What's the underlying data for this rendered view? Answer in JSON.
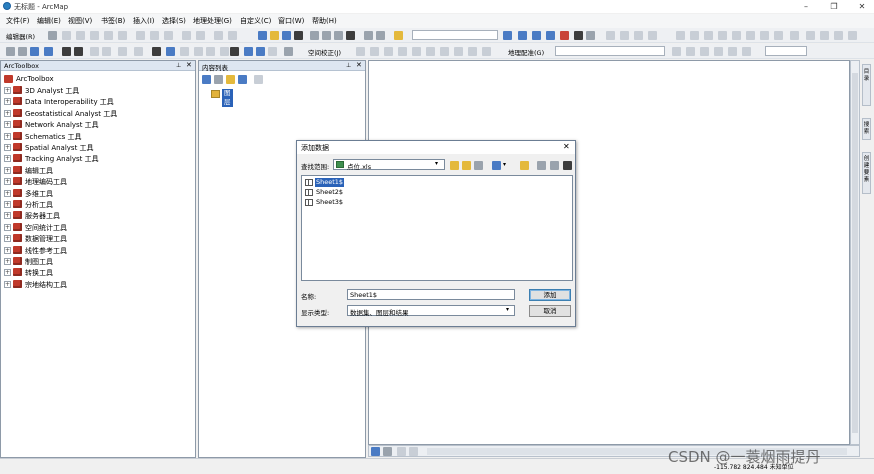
{
  "window": {
    "title": "无标题 - ArcMap"
  },
  "menu": [
    "文件(F)",
    "编辑(E)",
    "视图(V)",
    "书签(B)",
    "插入(I)",
    "选择(S)",
    "地理处理(G)",
    "自定义(C)",
    "窗口(W)",
    "帮助(H)"
  ],
  "toolbar": {
    "editor_label": "编辑器(R)",
    "spatial_adjust_label": "空间校正(J)",
    "georef_label": "地理配准(G)"
  },
  "arctoolbox": {
    "title": "ArcToolbox",
    "root": "ArcToolbox",
    "items": [
      "3D Analyst 工具",
      "Data Interoperability 工具",
      "Geostatistical Analyst 工具",
      "Network Analyst 工具",
      "Schematics 工具",
      "Spatial Analyst 工具",
      "Tracking Analyst 工具",
      "编辑工具",
      "地理编码工具",
      "多维工具",
      "分析工具",
      "服务器工具",
      "空间统计工具",
      "数据管理工具",
      "线性参考工具",
      "制图工具",
      "转换工具",
      "宗地结构工具"
    ]
  },
  "toc": {
    "title": "内容列表",
    "layer": "图层"
  },
  "dialog": {
    "title": "添加数据",
    "lookin_label": "查找范围:",
    "lookin_value": "点位.xls",
    "files": [
      "Sheet1$",
      "Sheet2$",
      "Sheet3$"
    ],
    "name_label": "名称:",
    "name_value": "Sheet1$",
    "type_label": "显示类型:",
    "type_value": "数据集、图层和结果",
    "add_button": "添加",
    "cancel_button": "取消"
  },
  "right_tabs": [
    "目录",
    "搜索",
    "创建要素"
  ],
  "status": {
    "coords": "-115.782  824.484 未知单位"
  },
  "watermark": "CSDN @一蓑烟雨提丹"
}
